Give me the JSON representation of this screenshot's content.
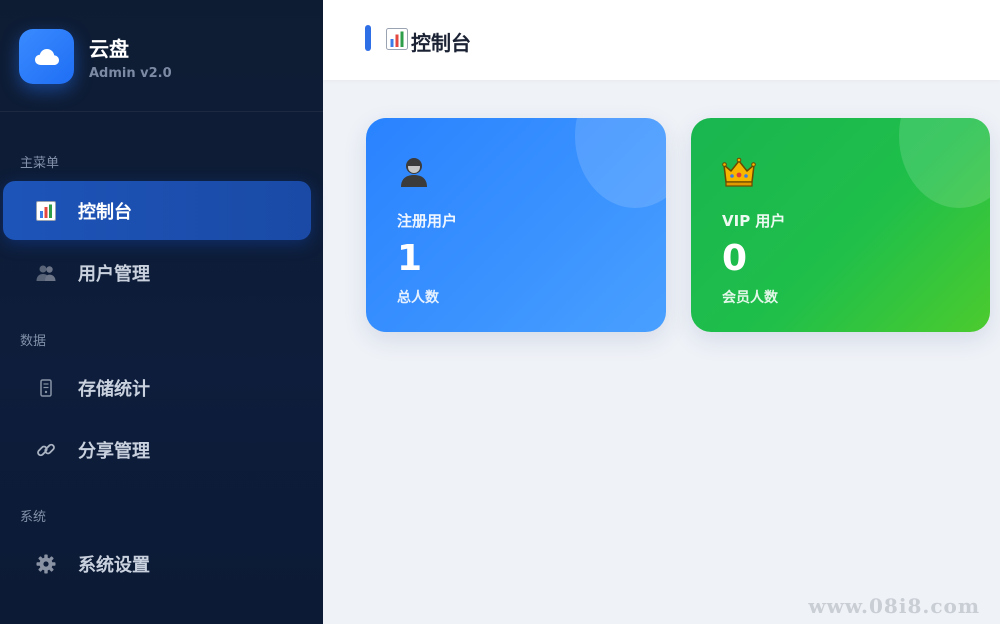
{
  "brand": {
    "name": "云盘",
    "version": "Admin v2.0"
  },
  "sidebar": {
    "sections": [
      {
        "label": "主菜单"
      },
      {
        "label": "数据"
      },
      {
        "label": "系统"
      }
    ],
    "items": [
      {
        "label": "控制台",
        "icon": "bar-chart-icon",
        "active": true
      },
      {
        "label": "用户管理",
        "icon": "users-icon",
        "active": false
      },
      {
        "label": "存储统计",
        "icon": "storage-icon",
        "active": false
      },
      {
        "label": "分享管理",
        "icon": "link-icon",
        "active": false
      },
      {
        "label": "系统设置",
        "icon": "gear-icon",
        "active": false
      }
    ]
  },
  "header": {
    "title": "控制台",
    "icon": "bar-chart-icon",
    "accent": "#2f6fe6"
  },
  "stats": [
    {
      "label": "注册用户",
      "value": "1",
      "sub": "总人数",
      "icon": "person-icon",
      "color": "#2a83ff"
    },
    {
      "label": "VIP 用户",
      "value": "0",
      "sub": "会员人数",
      "icon": "crown-icon",
      "color": "#1fbf4a"
    }
  ],
  "watermark": "www.08i8.com"
}
